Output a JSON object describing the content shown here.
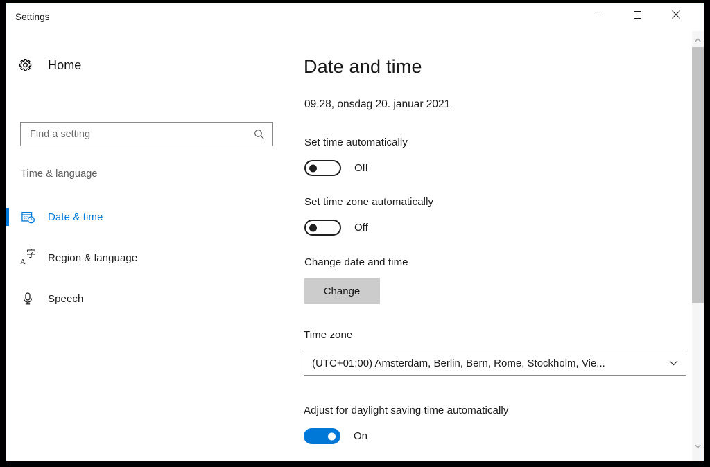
{
  "window": {
    "title": "Settings",
    "accent_color": "#0078d7",
    "border_color": "#4a9ae0",
    "caption": {
      "minimize_label": "Minimize",
      "maximize_label": "Maximize",
      "close_label": "Close"
    }
  },
  "sidebar": {
    "home": {
      "label": "Home",
      "icon": "gear-icon"
    },
    "search": {
      "placeholder": "Find a setting",
      "value": "",
      "icon": "search-icon"
    },
    "group_header": "Time & language",
    "items": [
      {
        "label": "Date & time",
        "icon": "calendar-clock-icon",
        "selected": true
      },
      {
        "label": "Region & language",
        "icon": "language-icon",
        "selected": false
      },
      {
        "label": "Speech",
        "icon": "microphone-icon",
        "selected": false
      }
    ]
  },
  "main": {
    "title": "Date and time",
    "current_datetime": "09.28, onsdag 20. januar 2021",
    "set_time_automatically": {
      "label": "Set time automatically",
      "state": "Off",
      "on": false
    },
    "set_timezone_automatically": {
      "label": "Set time zone automatically",
      "state": "Off",
      "on": false
    },
    "change_date_and_time": {
      "label": "Change date and time",
      "button_label": "Change"
    },
    "time_zone": {
      "label": "Time zone",
      "selected": "(UTC+01:00) Amsterdam, Berlin, Bern, Rome, Stockholm, Vie...",
      "chevron": "chevron-down-icon"
    },
    "daylight_saving": {
      "label": "Adjust for daylight saving time automatically",
      "state": "On",
      "on": true
    }
  },
  "scrollbar": {
    "up_arrow": "chevron-up-icon",
    "down_arrow": "chevron-down-icon"
  }
}
